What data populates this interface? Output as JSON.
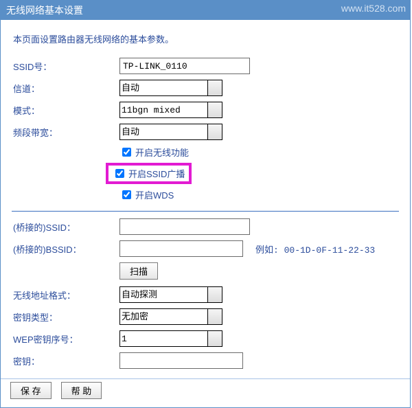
{
  "titlebar": {
    "title": "无线网络基本设置",
    "watermark": "www.it528.com"
  },
  "description": "本页面设置路由器无线网络的基本参数。",
  "labels": {
    "ssid": "SSID号：",
    "channel": "信道：",
    "mode": "模式：",
    "bandwidth": "频段带宽：",
    "bridge_ssid": "(桥接的)SSID：",
    "bridge_bssid": "(桥接的)BSSID：",
    "addr_format": "无线地址格式：",
    "key_type": "密钥类型：",
    "wep_index": "WEP密钥序号：",
    "key": "密钥："
  },
  "values": {
    "ssid": "TP-LINK_0110",
    "channel": "自动",
    "mode": "11bgn mixed",
    "bandwidth": "自动",
    "bridge_ssid": "",
    "bridge_bssid": "",
    "addr_format": "自动探测",
    "key_type": "无加密",
    "wep_index": "1",
    "key": ""
  },
  "checkboxes": {
    "enable_wireless": {
      "label": "开启无线功能",
      "checked": true
    },
    "enable_ssid_broadcast": {
      "label": "开启SSID广播",
      "checked": true
    },
    "enable_wds": {
      "label": "开启WDS",
      "checked": true
    }
  },
  "example_text": "例如: 00-1D-0F-11-22-33",
  "buttons": {
    "scan": "扫描",
    "save": "保 存",
    "help": "帮 助"
  }
}
